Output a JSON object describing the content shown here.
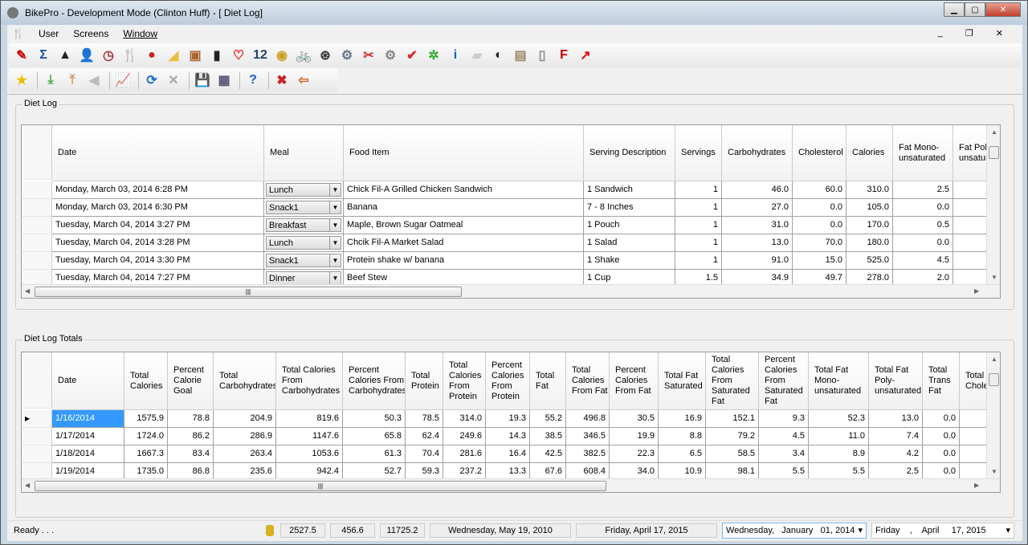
{
  "window": {
    "title": "BikePro - Development Mode (Clinton Huff) - [ Diet Log]"
  },
  "menu": {
    "items": [
      "User",
      "Screens",
      "Window"
    ]
  },
  "toolbar1": {
    "icons": [
      "report-icon",
      "sigma-icon",
      "mountain-icon",
      "user-icon",
      "speedometer-icon",
      "fork-knife-icon",
      "apple-icon",
      "cheese-icon",
      "food-box-icon",
      "phone-icon",
      "heart-map-icon",
      "calendar-icon",
      "stopwatch-icon",
      "bicycle-icon",
      "wheel-icon",
      "bike-parts-icon",
      "tools-icon",
      "gear-cassette-icon",
      "checkmark-icon",
      "gears-icon",
      "info-icon",
      "bear-icon",
      "cow-icon",
      "map-icon",
      "device-icon",
      "f-logo-icon",
      "chart-red-icon"
    ]
  },
  "toolbar2": {
    "icons": [
      "star-icon",
      "import-icon",
      "export-icon",
      "back-icon",
      "chart-icon",
      "refresh-icon",
      "delete-icon",
      "save-icon",
      "save-all-icon",
      "help-icon",
      "close-icon",
      "exit-icon"
    ]
  },
  "diet_log": {
    "label": "Diet Log",
    "columns": [
      "Date",
      "Meal",
      "Food Item",
      "Serving Description",
      "Servings",
      "Carbohydrates",
      "Cholesterol",
      "Calories",
      "Fat Mono-unsaturated",
      "Fat Poly unsatura"
    ],
    "rows": [
      [
        "Monday, March 03, 2014 6:28 PM",
        "Lunch",
        "Chick Fil-A Grilled Chicken Sandwich",
        "1 Sandwich",
        "1",
        "46.0",
        "60.0",
        "310.0",
        "2.5",
        ""
      ],
      [
        "Monday, March 03, 2014 6:30 PM",
        "Snack1",
        "Banana",
        "7 - 8 Inches",
        "1",
        "27.0",
        "0.0",
        "105.0",
        "0.0",
        ""
      ],
      [
        "Tuesday, March 04, 2014 3:27 PM",
        "Breakfast",
        "Maple, Brown Sugar Oatmeal",
        "1 Pouch",
        "1",
        "31.0",
        "0.0",
        "170.0",
        "0.5",
        ""
      ],
      [
        "Tuesday, March 04, 2014 3:28 PM",
        "Lunch",
        "Chcik Fil-A Market Salad",
        "1 Salad",
        "1",
        "13.0",
        "70.0",
        "180.0",
        "0.0",
        ""
      ],
      [
        "Tuesday, March 04, 2014 3:30 PM",
        "Snack1",
        "Protein shake w/ banana",
        "1 Shake",
        "1",
        "91.0",
        "15.0",
        "525.0",
        "4.5",
        ""
      ],
      [
        "Tuesday, March 04, 2014 7:27 PM",
        "Dinner",
        "Beef Stew",
        "1 Cup",
        "1.5",
        "34.9",
        "49.7",
        "278.0",
        "2.0",
        ""
      ]
    ]
  },
  "totals": {
    "label": "Diet Log Totals",
    "columns": [
      "Date",
      "Total Calories",
      "Percent Calorie Goal",
      "Total Carbohydrates",
      "Total Calories From Carbohydrates",
      "Percent Calories From Carbohydrates",
      "Total Protein",
      "Total Calories From Protein",
      "Percent Calories From Protein",
      "Total Fat",
      "Total Calories From Fat",
      "Percent Calories From Fat",
      "Total Fat Saturated",
      "Total Calories From Saturated Fat",
      "Percent Calories From Saturated Fat",
      "Total Fat Mono-unsaturated",
      "Total Fat Poly-unsaturated",
      "Total Trans Fat",
      "Total Choles"
    ],
    "rows": [
      [
        "1/16/2014",
        "1575.9",
        "78.8",
        "204.9",
        "819.6",
        "50.3",
        "78.5",
        "314.0",
        "19.3",
        "55.2",
        "496.8",
        "30.5",
        "16.9",
        "152.1",
        "9.3",
        "52.3",
        "13.0",
        "0.0",
        ""
      ],
      [
        "1/17/2014",
        "1724.0",
        "86.2",
        "286.9",
        "1147.6",
        "65.8",
        "62.4",
        "249.6",
        "14.3",
        "38.5",
        "346.5",
        "19.9",
        "8.8",
        "79.2",
        "4.5",
        "11.0",
        "7.4",
        "0.0",
        ""
      ],
      [
        "1/18/2014",
        "1667.3",
        "83.4",
        "263.4",
        "1053.6",
        "61.3",
        "70.4",
        "281.6",
        "16.4",
        "42.5",
        "382.5",
        "22.3",
        "6.5",
        "58.5",
        "3.4",
        "8.9",
        "4.2",
        "0.0",
        ""
      ],
      [
        "1/19/2014",
        "1735.0",
        "86.8",
        "235.6",
        "942.4",
        "52.7",
        "59.3",
        "237.2",
        "13.3",
        "67.6",
        "608.4",
        "34.0",
        "10.9",
        "98.1",
        "5.5",
        "5.5",
        "2.5",
        "0.0",
        ""
      ]
    ]
  },
  "status": {
    "text": "Ready . . .",
    "v1": "2527.5",
    "v2": "456.6",
    "v3": "11725.2",
    "date1": "Wednesday, May 19, 2010",
    "date2": "Friday, April 17, 2015",
    "picker1": "Wednesday,   January   01, 2014",
    "picker2": "Friday    ,    April     17, 2015"
  }
}
